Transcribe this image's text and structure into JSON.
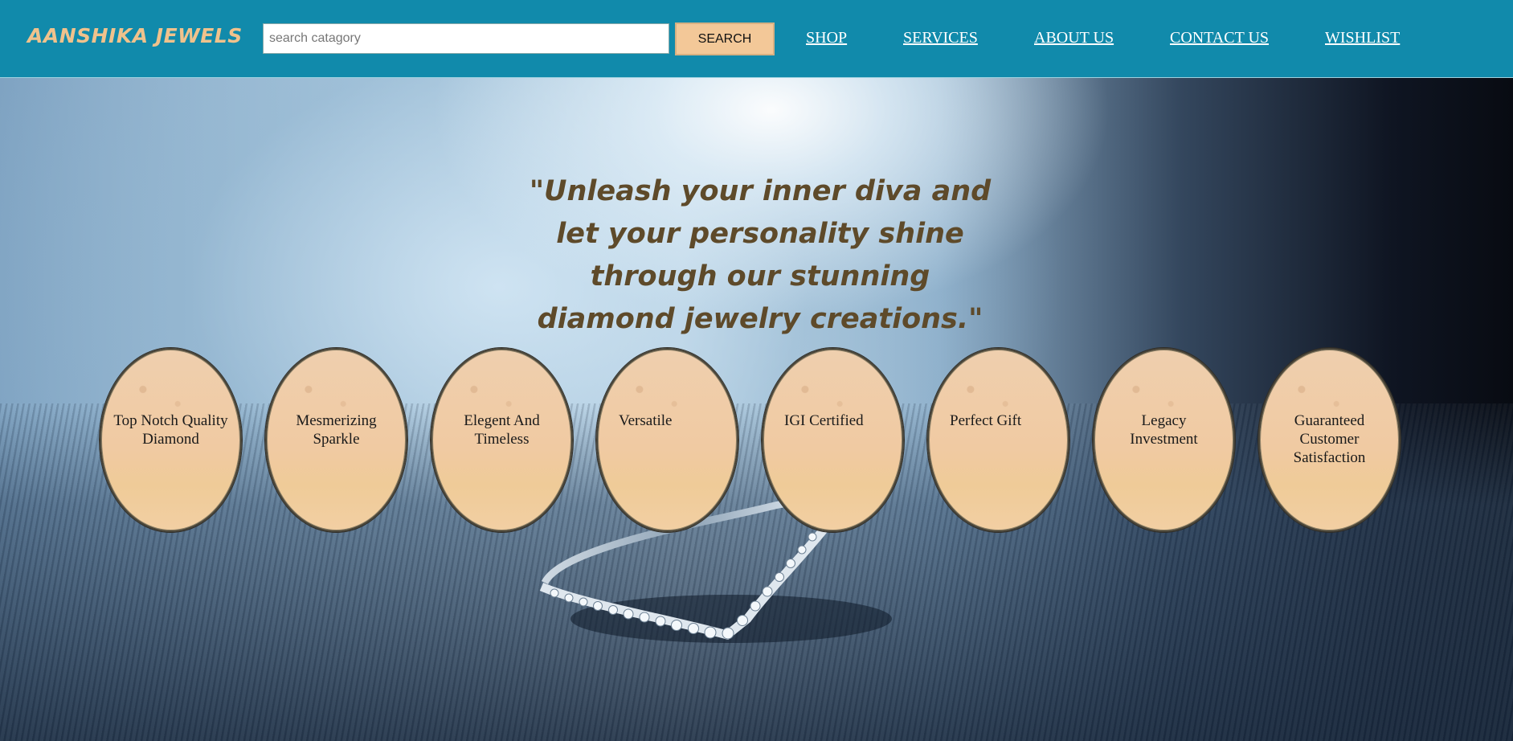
{
  "header": {
    "logo": "AANSHIKA JEWELS",
    "search": {
      "placeholder": "search catagory",
      "value": "",
      "button_label": "SEARCH"
    },
    "nav": [
      {
        "label": "SHOP"
      },
      {
        "label": "SERVICES"
      },
      {
        "label": "ABOUT US"
      },
      {
        "label": "CONTACT US"
      },
      {
        "label": "WISHLIST"
      }
    ]
  },
  "hero": {
    "tagline": "\"Unleash your inner diva and let your personality shine through our stunning diamond jewelry creations.\""
  },
  "features": [
    {
      "label": "Top Notch Quality Diamond"
    },
    {
      "label": "Mesmerizing Sparkle"
    },
    {
      "label": "Elegent And Timeless"
    },
    {
      "label": "Versatile"
    },
    {
      "label": "IGI Certified"
    },
    {
      "label": "Perfect Gift"
    },
    {
      "label": "Legacy Investment"
    },
    {
      "label": "Guaranteed Customer Satisfaction"
    }
  ],
  "colors": {
    "header_bg": "#118aab",
    "logo": "#f0c28c",
    "search_button_bg": "#f3c898",
    "tagline": "#5e4a2a",
    "oval_fill": "#efcba3"
  }
}
